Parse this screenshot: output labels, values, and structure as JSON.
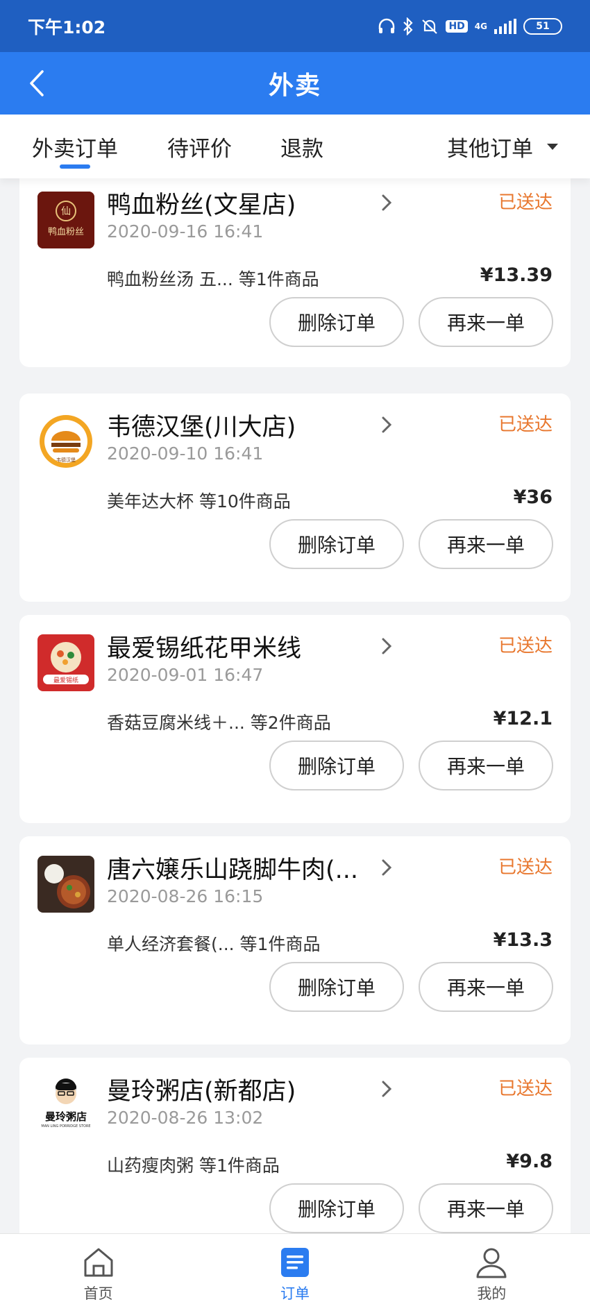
{
  "status_bar": {
    "time": "下午1:02",
    "hd": "HD",
    "network": "4G",
    "battery": "51"
  },
  "header": {
    "title": "外卖"
  },
  "tabs": [
    {
      "label": "外卖订单",
      "active": true
    },
    {
      "label": "待评价",
      "active": false
    },
    {
      "label": "退款",
      "active": false
    },
    {
      "label": "其他订单",
      "active": false
    }
  ],
  "orders": [
    {
      "shop": "鸭血粉丝(文星店)",
      "status": "已送达",
      "date": "2020-09-16 16:41",
      "items": "鸭血粉丝汤 五... 等1件商品",
      "price": "¥13.39",
      "logo_text": "鸭血粉丝",
      "delete_label": "删除订单",
      "reorder_label": "再来一单"
    },
    {
      "shop": "韦德汉堡(川大店)",
      "status": "已送达",
      "date": "2020-09-10 16:41",
      "items": "美年达大杯 等10件商品",
      "price": "¥36",
      "logo_text": "WEDE HAMBURGER",
      "delete_label": "删除订单",
      "reorder_label": "再来一单"
    },
    {
      "shop": "最爱锡纸花甲米线",
      "status": "已送达",
      "date": "2020-09-01 16:47",
      "items": "香菇豆腐米线＋... 等2件商品",
      "price": "¥12.1",
      "logo_text": "最爱锡纸",
      "delete_label": "删除订单",
      "reorder_label": "再来一单"
    },
    {
      "shop": "唐六嬢乐山跷脚牛肉(...",
      "status": "已送达",
      "date": "2020-08-26 16:15",
      "items": "单人经济套餐(... 等1件商品",
      "price": "¥13.3",
      "logo_text": "",
      "delete_label": "删除订单",
      "reorder_label": "再来一单"
    },
    {
      "shop": "曼玲粥店(新都店)",
      "status": "已送达",
      "date": "2020-08-26 13:02",
      "items": "山药瘦肉粥 等1件商品",
      "price": "¥9.8",
      "logo_text": "曼玲粥店",
      "logo_subtext": "MAN LING PORRIDGE STORE",
      "delete_label": "删除订单",
      "reorder_label": "再来一单"
    }
  ],
  "bottom_nav": [
    {
      "label": "首页",
      "icon": "home-icon",
      "active": false
    },
    {
      "label": "订单",
      "icon": "order-icon",
      "active": true
    },
    {
      "label": "我的",
      "icon": "user-icon",
      "active": false
    }
  ],
  "colors": {
    "status_bar": "#1f5fc1",
    "header": "#2b7cf0",
    "accent": "#2b7cf0",
    "status_text": "#e8772e"
  }
}
